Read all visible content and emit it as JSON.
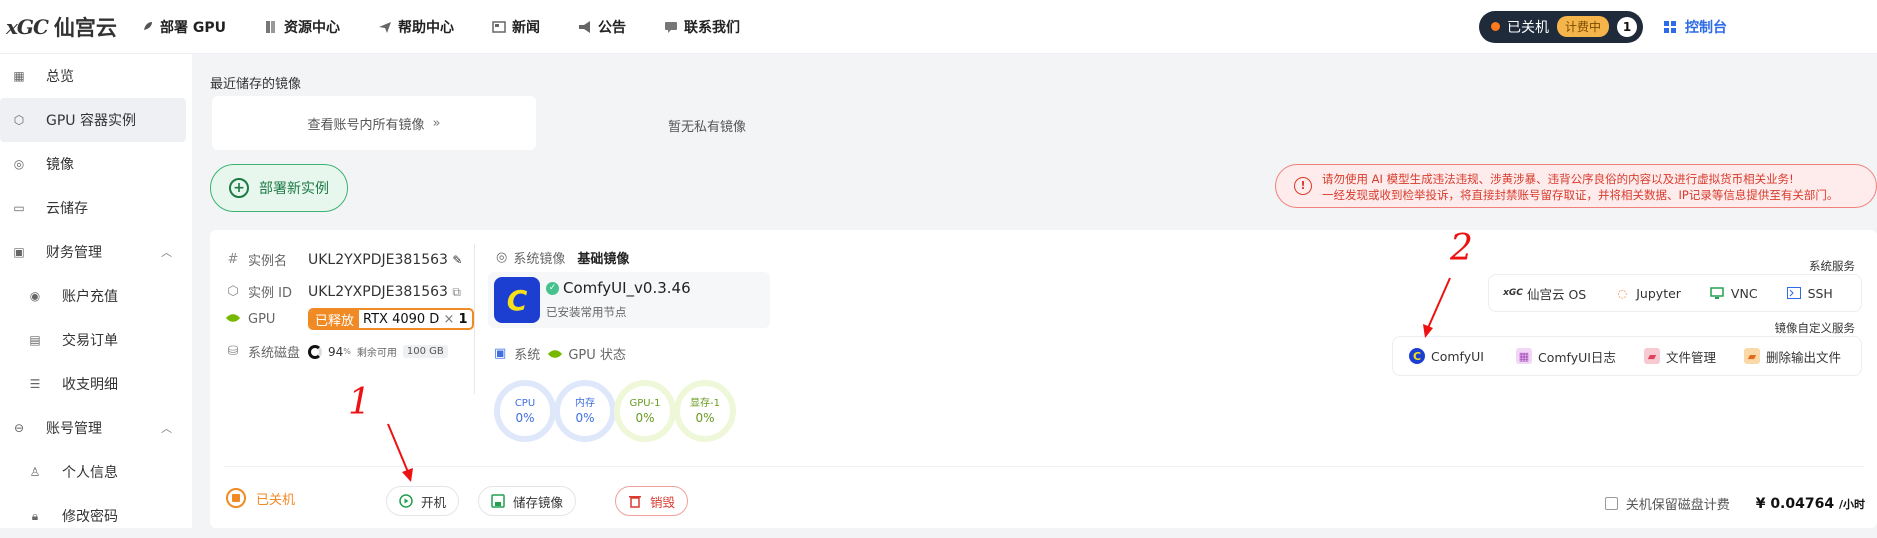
{
  "brand": {
    "logo_mark": "xGC",
    "name": "仙宫云"
  },
  "nav": [
    {
      "label": "部署 GPU",
      "icon": "rocket-icon"
    },
    {
      "label": "资源中心",
      "icon": "book-icon"
    },
    {
      "label": "帮助中心",
      "icon": "send-icon"
    },
    {
      "label": "新闻",
      "icon": "news-icon"
    },
    {
      "label": "公告",
      "icon": "megaphone-icon"
    },
    {
      "label": "联系我们",
      "icon": "chat-icon"
    }
  ],
  "top_status": {
    "state": "已关机",
    "billing": "计费中",
    "count": "1",
    "console": "控制台"
  },
  "sidebar": [
    {
      "label": "总览",
      "icon": "grid-icon"
    },
    {
      "label": "GPU 容器实例",
      "icon": "cube-icon",
      "active": true
    },
    {
      "label": "镜像",
      "icon": "disc-icon"
    },
    {
      "label": "云储存",
      "icon": "storage-icon"
    },
    {
      "label": "财务管理",
      "icon": "wallet-icon",
      "group": true
    },
    {
      "label": "账户充值",
      "icon": "coin-icon",
      "sub": true
    },
    {
      "label": "交易订单",
      "icon": "order-icon",
      "sub": true
    },
    {
      "label": "收支明细",
      "icon": "list-icon",
      "sub": true
    },
    {
      "label": "账号管理",
      "icon": "user-circle-icon",
      "group": true
    },
    {
      "label": "个人信息",
      "icon": "person-icon",
      "sub": true
    },
    {
      "label": "修改密码",
      "icon": "lock-icon",
      "sub": true
    }
  ],
  "main": {
    "recent_title": "最近储存的镜像",
    "view_all": "查看账号内所有镜像",
    "no_private": "暂无私有镜像",
    "deploy_new": "部署新实例",
    "warning_line1": "请勿使用 AI 模型生成违法违规、涉黄涉暴、违背公序良俗的内容以及进行虚拟货币相关业务!",
    "warning_line2": "一经发现或收到检举投诉，将直接封禁账号留存取证，并将相关数据、IP记录等信息提供至有关部门。"
  },
  "instance": {
    "name_label": "实例名",
    "name": "UKL2YXPDJE381563",
    "id_label": "实例 ID",
    "id": "UKL2YXPDJE381563",
    "gpu_label": "GPU",
    "gpu_released": "已释放",
    "gpu_model": "RTX 4090 D",
    "gpu_x": "×",
    "gpu_count": "1",
    "disk_label": "系统磁盘",
    "disk_pct": "94",
    "disk_unit": "%",
    "disk_remain": "剩余可用",
    "disk_size": "100 GB",
    "sysimg_label": "系统镜像",
    "sysimg_value": "基础镜像",
    "image_name": "ComfyUI_v0.3.46",
    "image_desc": "已安装常用节点",
    "status_label_sys": "系统",
    "status_label_gpu": "GPU 状态",
    "gauges": [
      {
        "label": "CPU",
        "value": "0%",
        "color": "#3f6fe0",
        "ring": "#dfe8fb"
      },
      {
        "label": "内存",
        "value": "0%",
        "color": "#3f6fe0",
        "ring": "#dfe8fb"
      },
      {
        "label": "GPU-1",
        "value": "0%",
        "color": "#6a9a22",
        "ring": "#eef7d8"
      },
      {
        "label": "显存-1",
        "value": "0%",
        "color": "#6a9a22",
        "ring": "#eef7d8"
      }
    ],
    "sys_services_title": "系统服务",
    "sys_services": [
      {
        "label": "仙宫云 OS",
        "icon": "xgc-icon"
      },
      {
        "label": "Jupyter",
        "icon": "jupyter-icon"
      },
      {
        "label": "VNC",
        "icon": "monitor-icon"
      },
      {
        "label": "SSH",
        "icon": "terminal-icon"
      }
    ],
    "custom_services_title": "镜像自定义服务",
    "custom_services": [
      {
        "label": "ComfyUI",
        "icon": "comfyui-icon"
      },
      {
        "label": "ComfyUI日志",
        "icon": "calendar-icon"
      },
      {
        "label": "文件管理",
        "icon": "folder-icon"
      },
      {
        "label": "删除输出文件",
        "icon": "folder-delete-icon"
      }
    ],
    "state": "已关机",
    "btn_start": "开机",
    "btn_save": "储存镜像",
    "btn_destroy": "销毁",
    "keep_disk": "关机保留磁盘计费",
    "price": "¥ 0.04764",
    "price_unit": "/小时"
  },
  "annotations": {
    "one": "1",
    "two": "2"
  }
}
